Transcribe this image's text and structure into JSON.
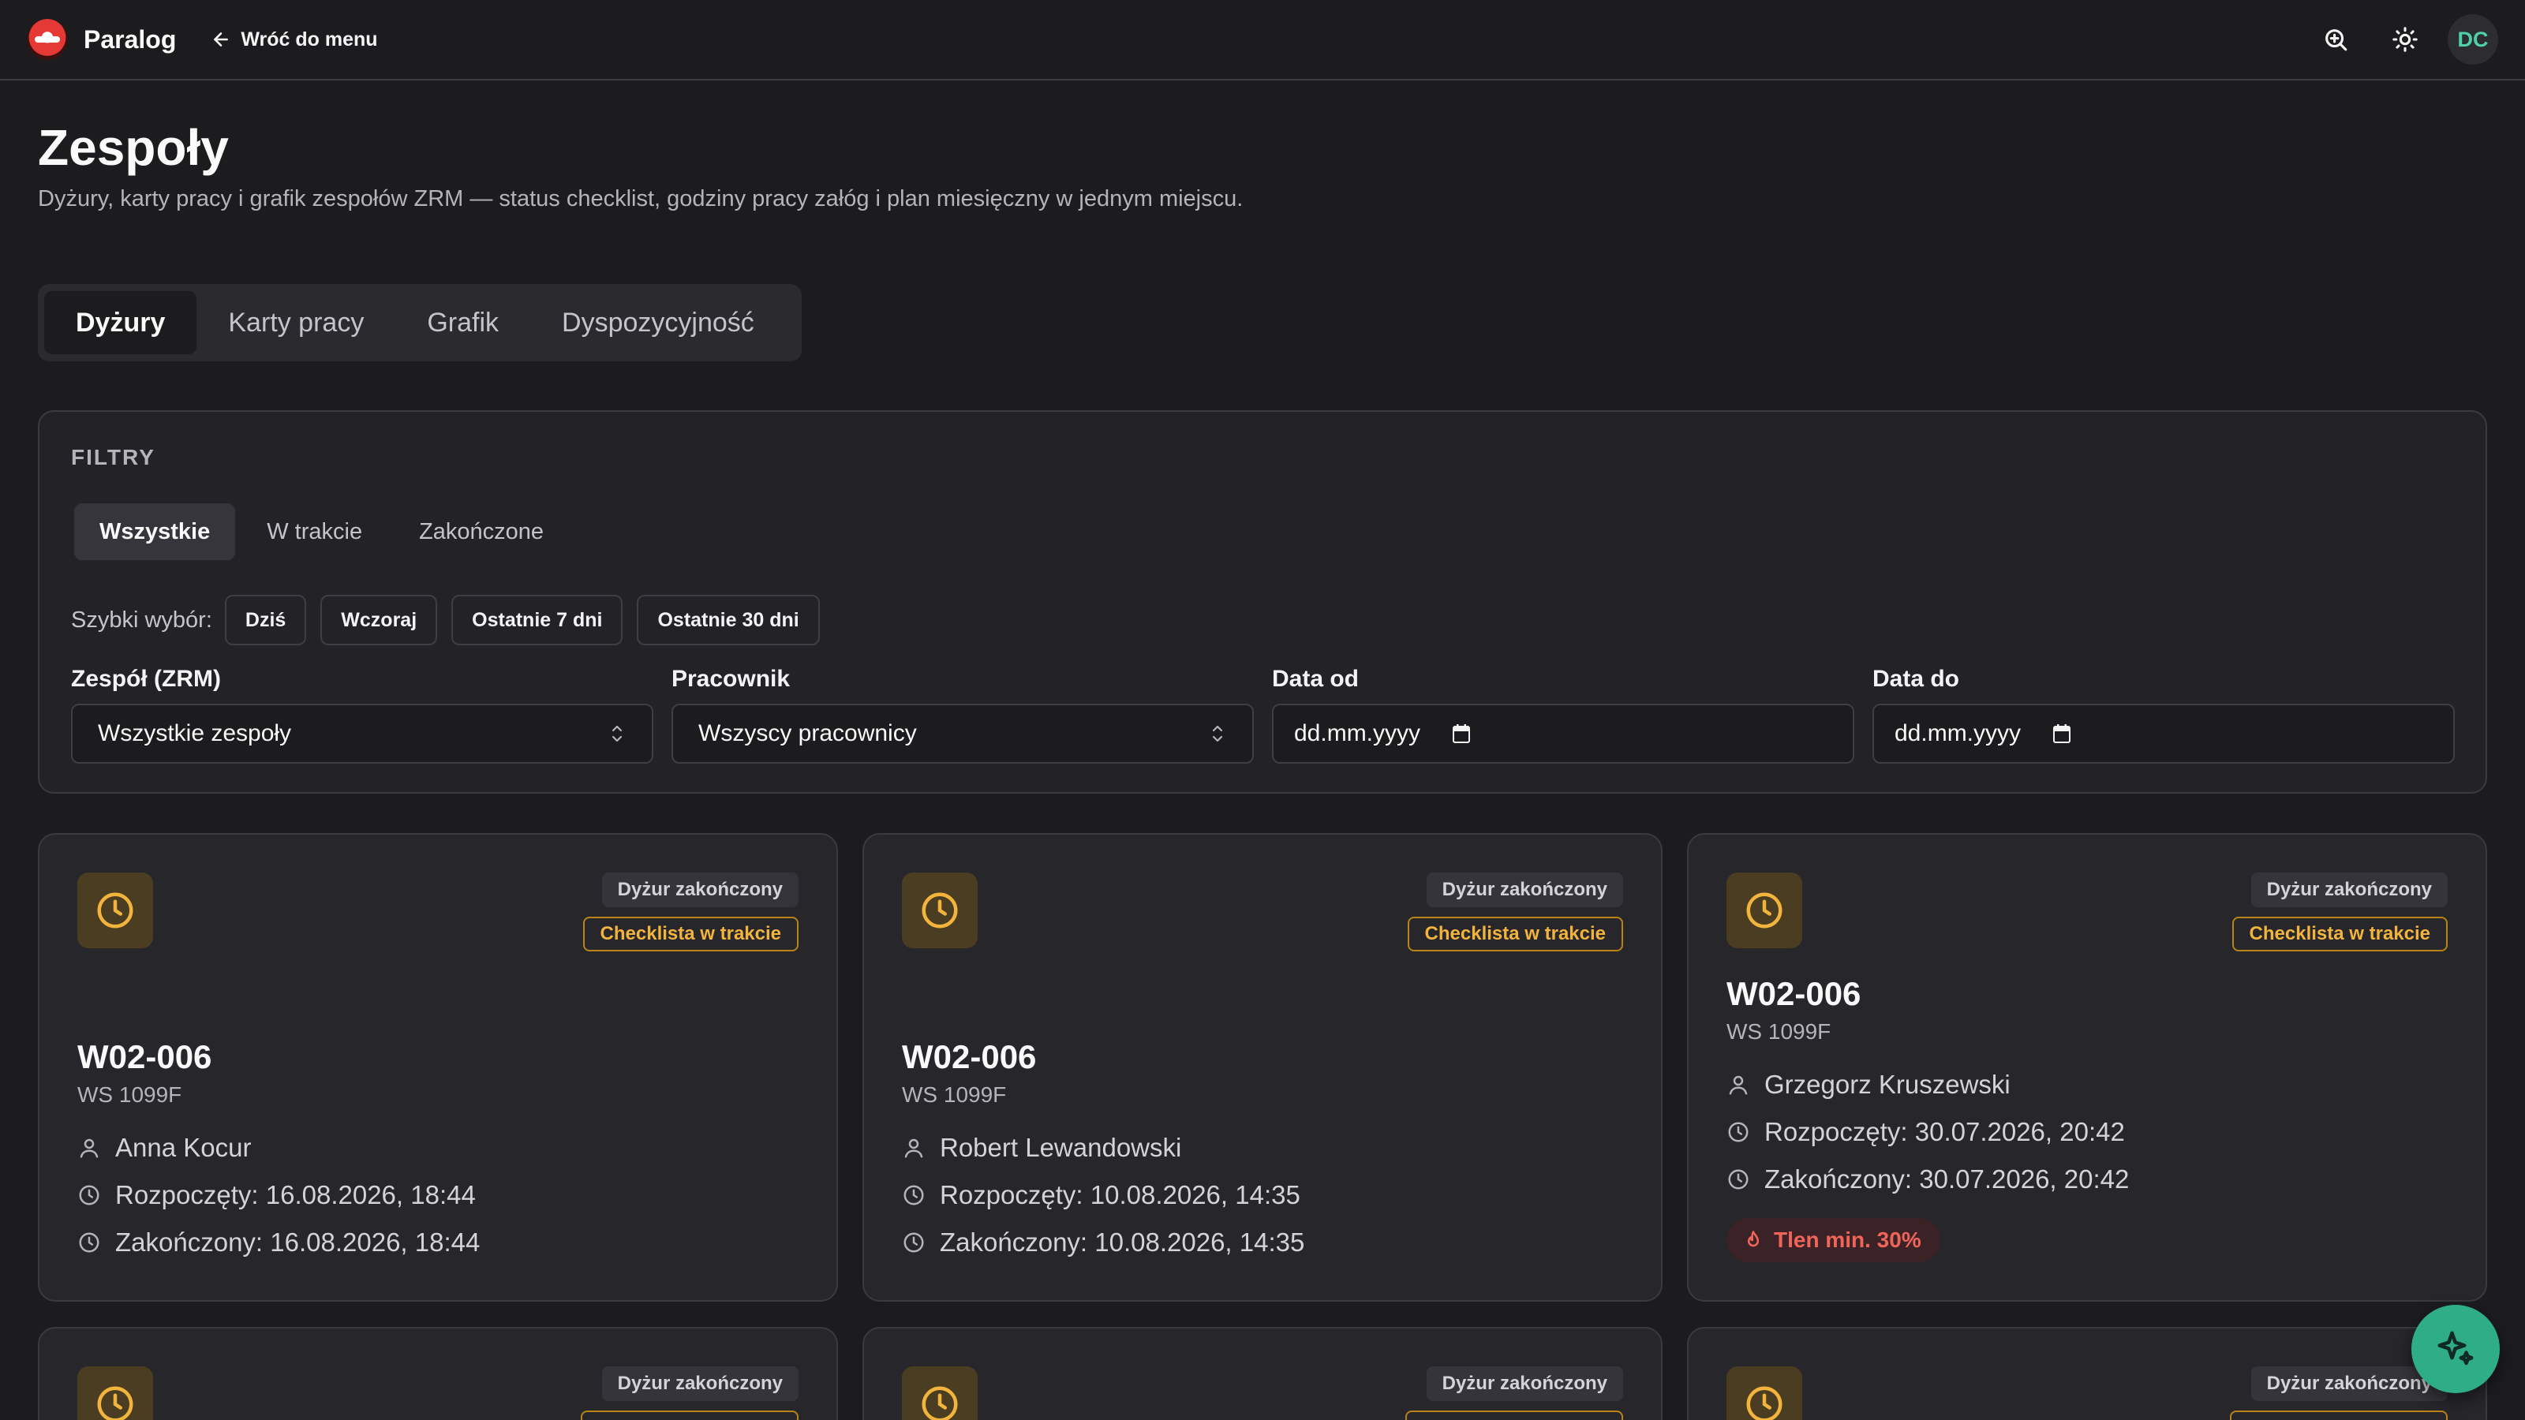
{
  "app": {
    "brand": "Paralog",
    "back_label": "Wróć do menu",
    "avatar_initials": "DC",
    "accent_color": "#2fae86"
  },
  "page": {
    "title": "Zespoły",
    "subtitle": "Dyżury, karty pracy i grafik zespołów ZRM — status checklist, godziny pracy załóg i plan miesięczny w jednym miejscu."
  },
  "tabs": [
    {
      "label": "Dyżury",
      "active": true
    },
    {
      "label": "Karty pracy",
      "active": false
    },
    {
      "label": "Grafik",
      "active": false
    },
    {
      "label": "Dyspozycyjność",
      "active": false
    }
  ],
  "filters": {
    "heading": "FILTRY",
    "status_options": [
      {
        "label": "Wszystkie",
        "active": true
      },
      {
        "label": "W trakcie",
        "active": false
      },
      {
        "label": "Zakończone",
        "active": false
      }
    ],
    "quick_label": "Szybki wybór:",
    "quick_options": [
      "Dziś",
      "Wczoraj",
      "Ostatnie 7 dni",
      "Ostatnie 30 dni"
    ],
    "team": {
      "label": "Zespół (ZRM)",
      "value": "Wszystkie zespoły"
    },
    "employee": {
      "label": "Pracownik",
      "value": "Wszyscy pracownicy"
    },
    "date_from": {
      "label": "Data od",
      "placeholder": "dd.mm.yyyy"
    },
    "date_to": {
      "label": "Data do",
      "placeholder": "dd.mm.yyyy"
    }
  },
  "cards": [
    {
      "shift_status": "Dyżur zakończony",
      "checklist_status": "Checklista w trakcie",
      "code": "W02-006",
      "vehicle": "WS 1099F",
      "employee": "Anna Kocur",
      "started": "Rozpoczęty: 16.08.2026, 18:44",
      "ended": "Zakończony: 16.08.2026, 18:44"
    },
    {
      "shift_status": "Dyżur zakończony",
      "checklist_status": "Checklista w trakcie",
      "code": "W02-006",
      "vehicle": "WS 1099F",
      "employee": "Robert Lewandowski",
      "started": "Rozpoczęty: 10.08.2026, 14:35",
      "ended": "Zakończony: 10.08.2026, 14:35"
    },
    {
      "shift_status": "Dyżur zakończony",
      "checklist_status": "Checklista w trakcie",
      "code": "W02-006",
      "vehicle": "WS 1099F",
      "employee": "Grzegorz Kruszewski",
      "started": "Rozpoczęty: 30.07.2026, 20:42",
      "ended": "Zakończony: 30.07.2026, 20:42",
      "alert": "Tlen min. 30%"
    },
    {
      "shift_status": "Dyżur zakończony"
    },
    {
      "shift_status": "Dyżur zakończony"
    },
    {
      "shift_status": "Dyżur zakończony"
    }
  ]
}
